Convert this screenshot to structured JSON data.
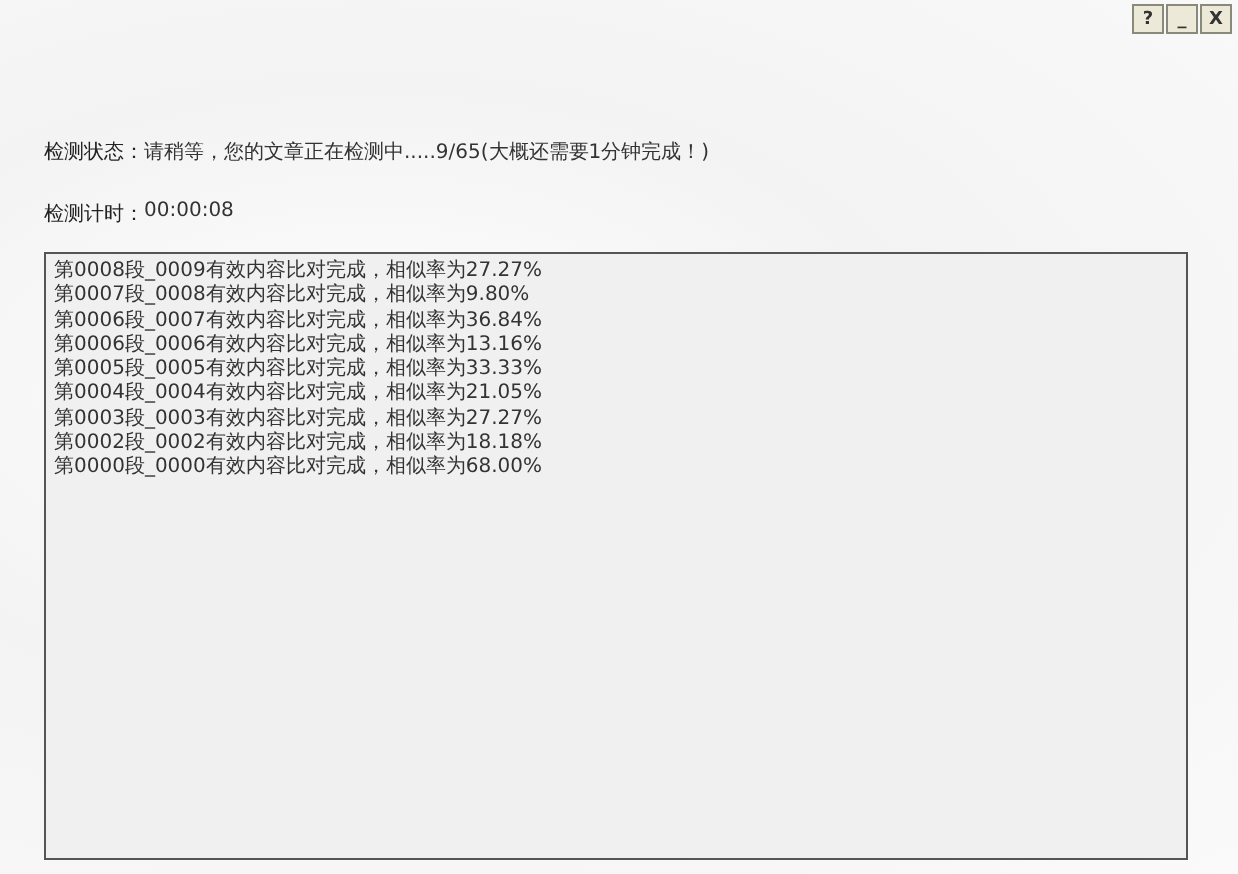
{
  "window_buttons": [
    "?",
    "_",
    "X"
  ],
  "status": {
    "label": "检测状态：",
    "text": "请稍等，您的文章正在检测中.....9/65(大概还需要1分钟完成！)"
  },
  "timer": {
    "label": "检测计时：",
    "value": "00:00:08"
  },
  "log_lines": [
    "第0008段_0009有效内容比对完成，相似率为27.27%",
    "第0007段_0008有效内容比对完成，相似率为9.80%",
    "第0006段_0007有效内容比对完成，相似率为36.84%",
    "第0006段_0006有效内容比对完成，相似率为13.16%",
    "第0005段_0005有效内容比对完成，相似率为33.33%",
    "第0004段_0004有效内容比对完成，相似率为21.05%",
    "第0003段_0003有效内容比对完成，相似率为27.27%",
    "第0002段_0002有效内容比对完成，相似率为18.18%",
    "第0000段_0000有效内容比对完成，相似率为68.00%"
  ]
}
